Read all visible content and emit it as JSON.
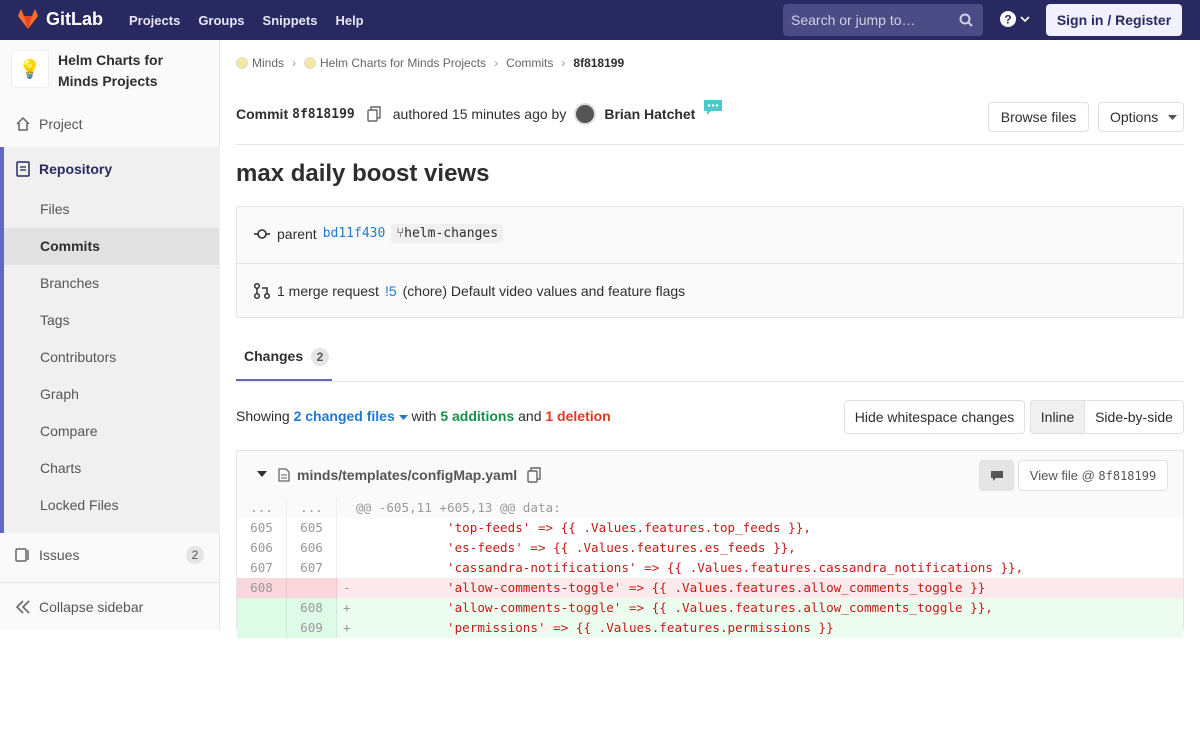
{
  "topbar": {
    "brand": "GitLab",
    "nav": [
      "Projects",
      "Groups",
      "Snippets",
      "Help"
    ],
    "search_placeholder": "Search or jump to…",
    "signin": "Sign in / Register"
  },
  "sidebar": {
    "project_name": "Helm Charts for Minds Projects",
    "items": {
      "project": "Project",
      "repository": "Repository",
      "issues": "Issues",
      "issues_count": "2",
      "collapse": "Collapse sidebar"
    },
    "repo_sub": [
      "Files",
      "Commits",
      "Branches",
      "Tags",
      "Contributors",
      "Graph",
      "Compare",
      "Charts",
      "Locked Files"
    ]
  },
  "breadcrumb": [
    "Minds",
    "Helm Charts for Minds Projects",
    "Commits",
    "8f818199"
  ],
  "commit": {
    "label": "Commit",
    "sha": "8f818199",
    "authored": "authored 15 minutes ago by",
    "author": "Brian Hatchet",
    "browse": "Browse files",
    "options": "Options",
    "title": "max daily boost views",
    "parent_label": "parent",
    "parent_sha": "bd11f430",
    "branch": "helm-changes",
    "mr_prefix": "1 merge request",
    "mr_id": "!5",
    "mr_title": "(chore) Default video values and feature flags"
  },
  "tabs": {
    "changes": "Changes",
    "changes_count": "2"
  },
  "summary": {
    "showing": "Showing",
    "changed": "2 changed files",
    "with": "with",
    "additions": "5 additions",
    "and": "and",
    "deletions": "1 deletion",
    "hide_ws": "Hide whitespace changes",
    "inline": "Inline",
    "side": "Side-by-side"
  },
  "file": {
    "path": "minds/templates/configMap.yaml",
    "view": "View file @",
    "view_sha": "8f818199"
  },
  "diff": [
    {
      "type": "meta",
      "a": "...",
      "b": "...",
      "text": "@@ -605,11 +605,13 @@ data:"
    },
    {
      "type": "ctx",
      "a": "605",
      "b": "605",
      "text": "            'top-feeds' => {{ .Values.features.top_feeds }},"
    },
    {
      "type": "ctx",
      "a": "606",
      "b": "606",
      "text": "            'es-feeds' => {{ .Values.features.es_feeds }},"
    },
    {
      "type": "ctx",
      "a": "607",
      "b": "607",
      "text": "            'cassandra-notifications' => {{ .Values.features.cassandra_notifications }},"
    },
    {
      "type": "del",
      "a": "608",
      "b": "",
      "text": "            'allow-comments-toggle' => {{ .Values.features.allow_comments_toggle }}"
    },
    {
      "type": "add",
      "a": "",
      "b": "608",
      "text": "            'allow-comments-toggle' => {{ .Values.features.allow_comments_toggle }},"
    },
    {
      "type": "add",
      "a": "",
      "b": "609",
      "text": "            'permissions' => {{ .Values.features.permissions }}"
    }
  ]
}
